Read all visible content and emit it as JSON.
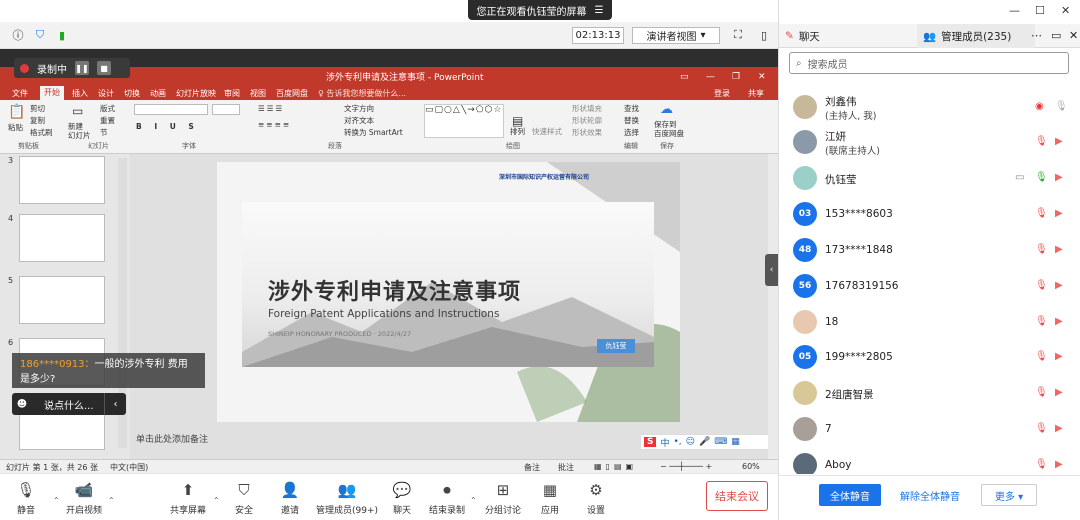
{
  "banner": {
    "text": "您正在观看仇钰莹的屏幕",
    "icon": "menu-icon"
  },
  "toolbar": {
    "timer": "02:13:13",
    "presenter_view": "演讲者视图"
  },
  "recording": {
    "label": "录制中"
  },
  "ppt": {
    "title": "涉外专利申请及注意事项 - PowerPoint",
    "menu": [
      "文件",
      "开始",
      "插入",
      "设计",
      "切换",
      "动画",
      "幻灯片放映",
      "审阅",
      "视图",
      "百度网盘"
    ],
    "active_menu": "开始",
    "tell_me": "♀ 告诉我您想要做什么...",
    "login": "登录",
    "share": "共享",
    "ribbon_groups": [
      "剪贴板",
      "幻灯片",
      "字体",
      "段落",
      "绘图",
      "编辑",
      "保存"
    ],
    "ribbon_items": {
      "paste": "粘贴",
      "cut": "剪切",
      "copy": "复制",
      "format_painter": "格式刷",
      "new_slide": "新建\n幻灯片",
      "layout": "版式",
      "reset": "重置",
      "section": "节",
      "text_direction": "文字方向",
      "align_text": "对齐文本",
      "smartart": "转换为 SmartArt",
      "arrange": "排列",
      "quick_styles": "快速样式",
      "shape_fill": "形状填充",
      "shape_outline": "形状轮廓",
      "shape_effect": "形状效果",
      "find": "查找",
      "replace": "替换",
      "select": "选择",
      "save_baidu": "保存到\n百度网盘"
    }
  },
  "slides_pane": {
    "numbers": [
      "3",
      "4",
      "5",
      "6"
    ]
  },
  "slide": {
    "title": "涉外专利申请及注意事项",
    "subtitle": "Foreign Patent Applications and Instructions",
    "meta_left": "SHINEIP HONORARY PRODUCED",
    "meta_date": "2022/4/27",
    "presenter": "仇钰莹",
    "logo_text": "深圳市国际知识产权运营有限公司"
  },
  "notes_placeholder": "单击此处添加备注",
  "status": {
    "slide_info": "幻灯片 第 1 张，共 26 张",
    "language": "中文(中国)",
    "notes": "备注",
    "comments": "批注",
    "zoom": "60%"
  },
  "chat": {
    "sender": "186****0913：",
    "message": "一般的涉外专利  费用是多少?",
    "input_placeholder": "说点什么..."
  },
  "bottom_bar": [
    {
      "label": "静音",
      "icon": "microphone-icon"
    },
    {
      "label": "开启视频",
      "icon": "video-off-icon"
    },
    {
      "label": "共享屏幕",
      "icon": "share-screen-icon"
    },
    {
      "label": "安全",
      "icon": "shield-icon"
    },
    {
      "label": "邀请",
      "icon": "invite-icon"
    },
    {
      "label": "管理成员(99+)",
      "icon": "members-icon"
    },
    {
      "label": "聊天",
      "icon": "chat-icon"
    },
    {
      "label": "结束录制",
      "icon": "stop-record-icon"
    },
    {
      "label": "分组讨论",
      "icon": "breakout-icon"
    },
    {
      "label": "应用",
      "icon": "apps-icon"
    },
    {
      "label": "设置",
      "icon": "gear-icon"
    }
  ],
  "end_meeting": "结束会议",
  "right_panel": {
    "tab_chat": "聊天",
    "tab_members": "管理成员(235)",
    "search_placeholder": "搜索成员",
    "members": [
      {
        "name": "刘鑫伟",
        "role": "(主持人, 我)",
        "avatar": "",
        "color": "#c8b89a"
      },
      {
        "name": "江妍",
        "role": "(联席主持人)",
        "avatar": "",
        "color": "#8a9aa8"
      },
      {
        "name": "仇钰莹",
        "role": "",
        "avatar": "",
        "color": "#9ad0c8"
      },
      {
        "name": "153****8603",
        "role": "",
        "avatar": "03",
        "color": "#1a73e8"
      },
      {
        "name": "173****1848",
        "role": "",
        "avatar": "48",
        "color": "#1a73e8"
      },
      {
        "name": "17678319156",
        "role": "",
        "avatar": "56",
        "color": "#1a73e8"
      },
      {
        "name": "18",
        "role": "",
        "avatar": "",
        "color": "#e8c8b0"
      },
      {
        "name": "199****2805",
        "role": "",
        "avatar": "05",
        "color": "#1a73e8"
      },
      {
        "name": "2组唐智景",
        "role": "",
        "avatar": "",
        "color": "#d8c898"
      },
      {
        "name": "7",
        "role": "",
        "avatar": "",
        "color": "#a8a098"
      },
      {
        "name": "Aboy",
        "role": "",
        "avatar": "",
        "color": "#5a6a7a"
      }
    ],
    "footer": {
      "mute_all": "全体静音",
      "unmute_all": "解除全体静音",
      "more": "更多 ▾"
    }
  }
}
